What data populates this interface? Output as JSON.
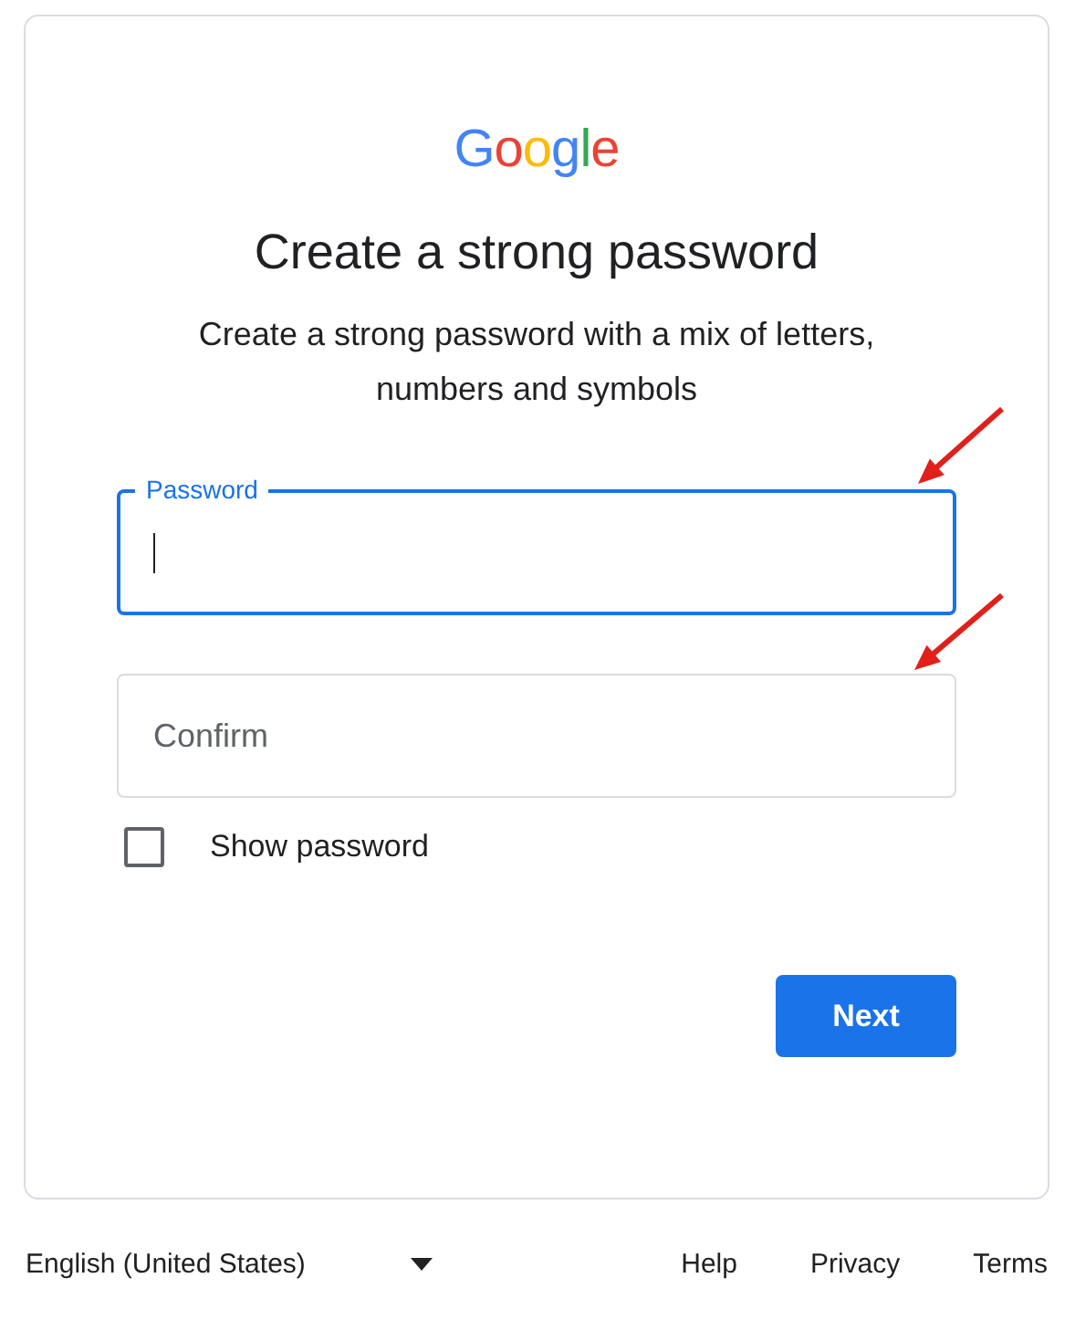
{
  "logo": "Google",
  "title": "Create a strong password",
  "subtitle": "Create a strong password with a mix of letters, numbers and symbols",
  "fields": [
    {
      "label": "Password",
      "focused": true
    },
    {
      "label": "Confirm",
      "focused": false
    }
  ],
  "show_password": {
    "label": "Show password",
    "checked": false
  },
  "next_button": "Next",
  "footer": {
    "language": "English (United States)",
    "links": [
      "Help",
      "Privacy",
      "Terms"
    ]
  },
  "annotations": [
    {
      "kind": "arrow"
    },
    {
      "kind": "arrow"
    }
  ]
}
